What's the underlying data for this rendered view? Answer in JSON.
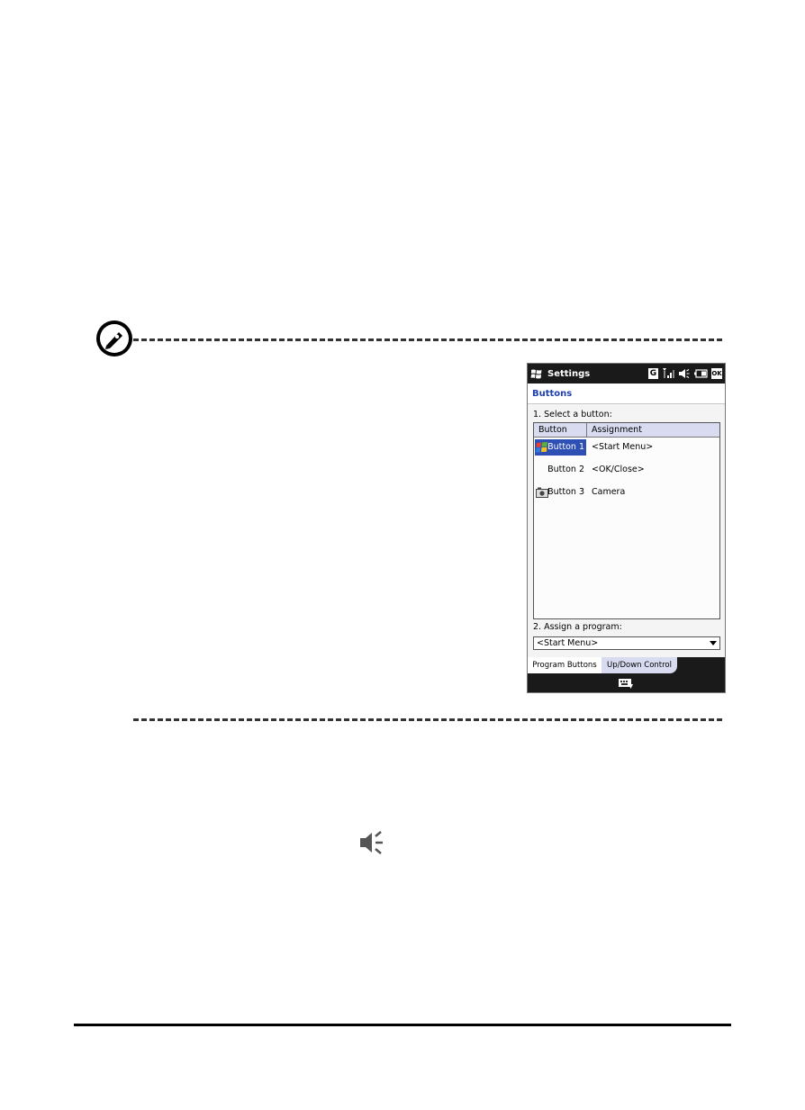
{
  "phone": {
    "window_title": "Settings",
    "status": {
      "network": "G",
      "ok": "OK"
    },
    "page_header": "Buttons",
    "select_label": "1. Select a button:",
    "table": {
      "columns": [
        "Button",
        "Assignment"
      ],
      "rows": [
        {
          "button": "Button 1",
          "assignment": "<Start Menu>",
          "icon": "windows-flag-icon",
          "selected": true
        },
        {
          "button": "Button 2",
          "assignment": "<OK/Close>",
          "icon": "",
          "selected": false
        },
        {
          "button": "Button 3",
          "assignment": "Camera",
          "icon": "camera-icon",
          "selected": false
        }
      ]
    },
    "assign_label": "2. Assign a program:",
    "dropdown_value": "<Start Menu>",
    "tabs": [
      "Program Buttons",
      "Up/Down Control"
    ],
    "active_tab": "Program Buttons"
  },
  "colors": {
    "selection": "#2e4fb4",
    "header_blue": "#1f3fb0",
    "table_header": "#d9dcf1",
    "bar_dark": "#1a1a1a"
  }
}
